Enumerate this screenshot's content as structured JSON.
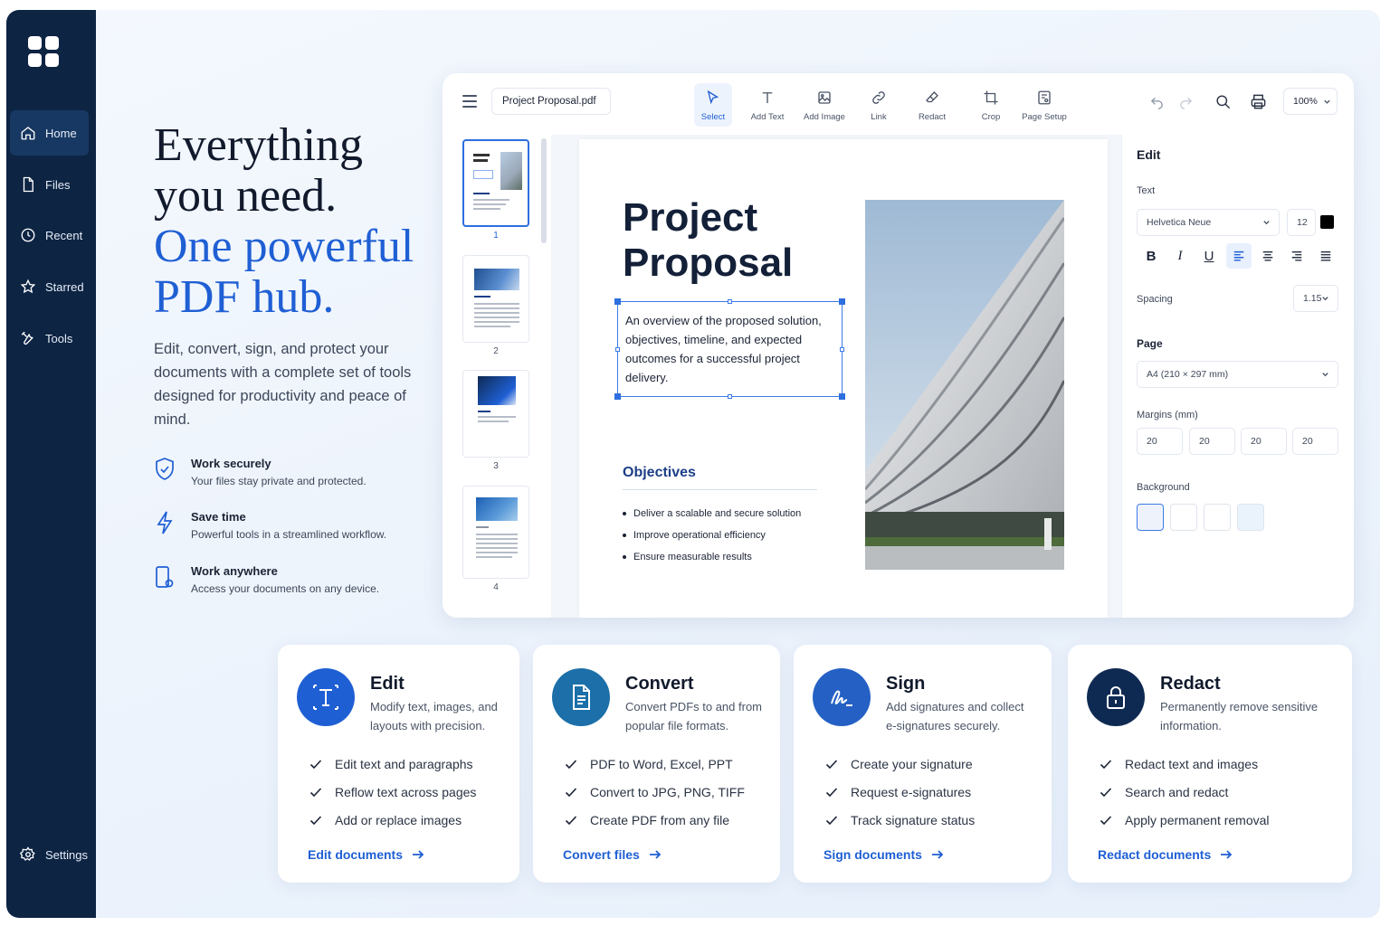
{
  "sidebar": {
    "items": [
      {
        "label": "Home",
        "icon": "home-icon"
      },
      {
        "label": "Files",
        "icon": "file-icon"
      },
      {
        "label": "Recent",
        "icon": "clock-icon"
      },
      {
        "label": "Starred",
        "icon": "star-icon"
      },
      {
        "label": "Tools",
        "icon": "tools-icon"
      }
    ],
    "settings_label": "Settings"
  },
  "hero": {
    "title_dark_1": "Everything",
    "title_dark_2": "you need.",
    "title_blue_1": "One powerful",
    "title_blue_2": "PDF hub.",
    "subtitle": "Edit, convert, sign, and protect your documents with a complete set of tools designed for productivity and peace of mind.",
    "features": [
      {
        "title": "Work securely",
        "desc": "Your files stay private and protected.",
        "icon": "shield-check-icon"
      },
      {
        "title": "Save time",
        "desc": "Powerful tools in a streamlined workflow.",
        "icon": "lightning-icon"
      },
      {
        "title": "Work anywhere",
        "desc": "Access your documents on any device.",
        "icon": "devices-icon"
      }
    ]
  },
  "editor": {
    "filename": "Project Proposal.pdf",
    "tools": [
      "Select",
      "Add Text",
      "Add Image",
      "Link",
      "Redact",
      "Crop",
      "Page Setup"
    ],
    "zoom": "100%",
    "thumb_numbers": [
      "1",
      "2",
      "3",
      "4"
    ],
    "document": {
      "title_1": "Project",
      "title_2": "Proposal",
      "intro": "An overview of the proposed solution, objectives, timeline, and expected outcomes for a successful project delivery.",
      "objectives_title": "Objectives",
      "objectives": [
        "Deliver a scalable and secure solution",
        "Improve operational efficiency",
        "Ensure measurable results"
      ]
    },
    "props": {
      "heading": "Edit",
      "text_label": "Text",
      "font": "Helvetica Neue",
      "font_size": "12",
      "text_color": "#000000",
      "spacing_label": "Spacing",
      "spacing_value": "1.15",
      "page_label": "Page",
      "page_size": "A4 (210 × 297 mm)",
      "margins_label": "Margins (mm)",
      "margins": [
        "20",
        "20",
        "20",
        "20"
      ],
      "background_label": "Background"
    }
  },
  "cards": [
    {
      "title": "Edit",
      "desc": "Modify text, images, and layouts with precision.",
      "items": [
        "Edit text and paragraphs",
        "Reflow text across pages",
        "Add or replace images"
      ],
      "link": "Edit documents",
      "color": "#1f5fd4",
      "icon": "text-t-icon"
    },
    {
      "title": "Convert",
      "desc": "Convert PDFs to and from popular file formats.",
      "items": [
        "PDF to Word, Excel, PPT",
        "Convert to JPG, PNG, TIFF",
        "Create PDF from any file"
      ],
      "link": "Convert files",
      "color": "#1c6fa8",
      "icon": "document-icon"
    },
    {
      "title": "Sign",
      "desc": "Add signatures and collect e-signatures securely.",
      "items": [
        "Create your signature",
        "Request e-signatures",
        "Track signature status"
      ],
      "link": "Sign documents",
      "color": "#2561c4",
      "icon": "signature-icon"
    },
    {
      "title": "Redact",
      "desc": "Permanently remove sensitive information.",
      "items": [
        "Redact text and images",
        "Search and redact",
        "Apply permanent removal"
      ],
      "link": "Redact documents",
      "color": "#0f2a52",
      "icon": "lock-icon"
    }
  ]
}
